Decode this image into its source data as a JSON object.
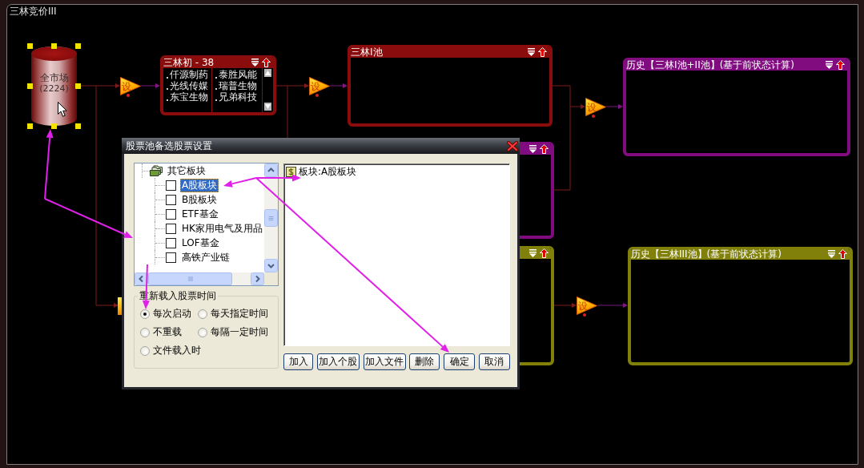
{
  "window": {
    "title": "三林竞价III"
  },
  "canvas": {
    "source": {
      "label": "全市场",
      "count": "(2224)",
      "selected": true
    },
    "filters": [
      {
        "label": "设",
        "selected": false
      },
      {
        "label": "设",
        "selected": false
      },
      {
        "label": "设",
        "selected": false
      },
      {
        "label": "设",
        "selected": false
      }
    ],
    "pools": [
      {
        "title": "三林初 - 38",
        "color": "#8b0c0c",
        "selected": false,
        "stocks": [
          "仟源制药",
          "泰胜风能",
          "光线传媒",
          "瑞普生物",
          "东宝生物",
          "兄弟科技"
        ]
      },
      {
        "title": "三林I池",
        "color": "#8b0c0c",
        "selected": false
      },
      {
        "color": "#800c80",
        "selected": false
      },
      {
        "color": "#80800a",
        "selected": false
      },
      {
        "title": "历史【三林I池+II池】(基于前状态计算)",
        "color": "#800c80",
        "selected": false
      },
      {
        "title": "历史【三林III池】(基于前状态计算)",
        "color": "#80800a",
        "selected": false
      }
    ]
  },
  "dialog": {
    "title": "股票池备选股票设置",
    "tree": [
      {
        "label": "其它板块",
        "selected": false,
        "children": [
          {
            "label": "A股板块",
            "checked": false,
            "selected": true
          },
          {
            "label": "B股板块",
            "checked": false,
            "selected": false
          },
          {
            "label": "ETF基金",
            "checked": false,
            "selected": false
          },
          {
            "label": "HK家用电气及用品",
            "checked": false,
            "selected": false
          },
          {
            "label": "LOF基金",
            "checked": false,
            "selected": false
          },
          {
            "label": "高铁产业链",
            "checked": false,
            "selected": false
          }
        ]
      }
    ],
    "reload_time": {
      "title": "重新载入股票时间",
      "options": [
        {
          "label": "每次启动",
          "selected": true
        },
        {
          "label": "每天指定时间",
          "selected": false
        },
        {
          "label": "不重载",
          "selected": false
        },
        {
          "label": "每隔一定时间",
          "selected": false
        },
        {
          "label": "文件载入时",
          "selected": false
        }
      ]
    },
    "selected_items": [
      {
        "label": "板块:A股板块"
      }
    ],
    "buttons": [
      "加入",
      "加入个股",
      "加入文件",
      "删除",
      "确定",
      "取消"
    ]
  }
}
